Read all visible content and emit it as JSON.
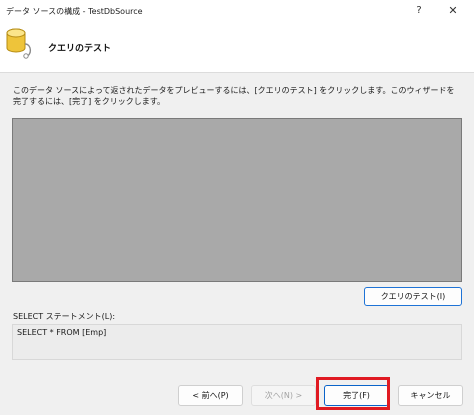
{
  "window": {
    "title": "データ ソースの構成 - TestDbSource",
    "help_glyph": "?",
    "close_glyph": "✕"
  },
  "header": {
    "icon": "database-icon",
    "title": "クエリのテスト"
  },
  "main": {
    "instruction": "このデータ ソースによって返されたデータをプレビューするには、[クエリのテスト] をクリックします。このウィザードを完了するには、[完了] をクリックします。",
    "test_query_button": "クエリのテスト(I)",
    "select_label": "SELECT ステートメント(L):",
    "select_statement": "SELECT * FROM [Emp]"
  },
  "buttons": {
    "back": "< 前へ(P)",
    "next": "次へ(N) >",
    "finish": "完了(F)",
    "cancel": "キャンセル"
  },
  "colors": {
    "highlight": "#e01a22",
    "accent": "#1e73d6",
    "preview_background": "#a9a9a9"
  }
}
